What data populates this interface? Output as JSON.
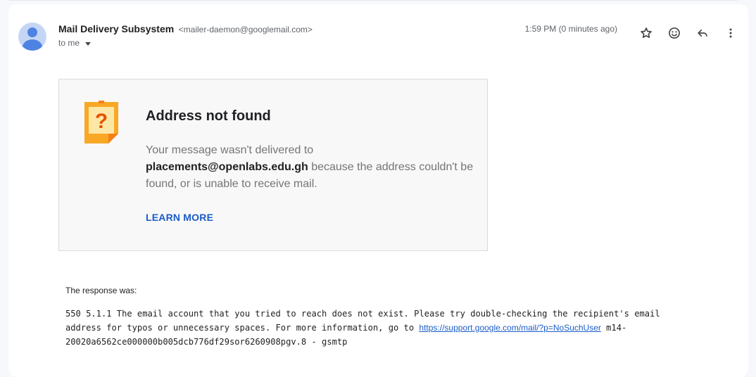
{
  "message": {
    "sender_name": "Mail Delivery Subsystem",
    "sender_email": "<mailer-daemon@googlemail.com>",
    "to_label": "to me",
    "time": "1:59 PM (0 minutes ago)"
  },
  "icons": [
    "person-icon",
    "star-icon",
    "emoji-icon",
    "reply-icon",
    "more-vert-icon",
    "question-note-icon"
  ],
  "colors": {
    "accent": "#1a5cc8",
    "warning": "#f9a825"
  },
  "bounce": {
    "title": "Address not found",
    "text_before": "Your message wasn't delivered to",
    "address": "placements@openlabs.edu.gh",
    "text_after": " because the address couldn't be found, or is unable to receive mail.",
    "learn_more": "LEARN MORE"
  },
  "response": {
    "label": "The response was:",
    "line1": "550 5.1.1 The email account that you tried to reach does not exist. Please try double-checking the recipient's email",
    "line2_before": "address for typos or unnecessary spaces. For more information, go to ",
    "link": "https://support.google.com/mail/?p=NoSuchUser",
    "line2_after": " m14-",
    "line3": "20020a6562ce000000b005dcb776df29sor6260908pgv.8 - gsmtp"
  }
}
